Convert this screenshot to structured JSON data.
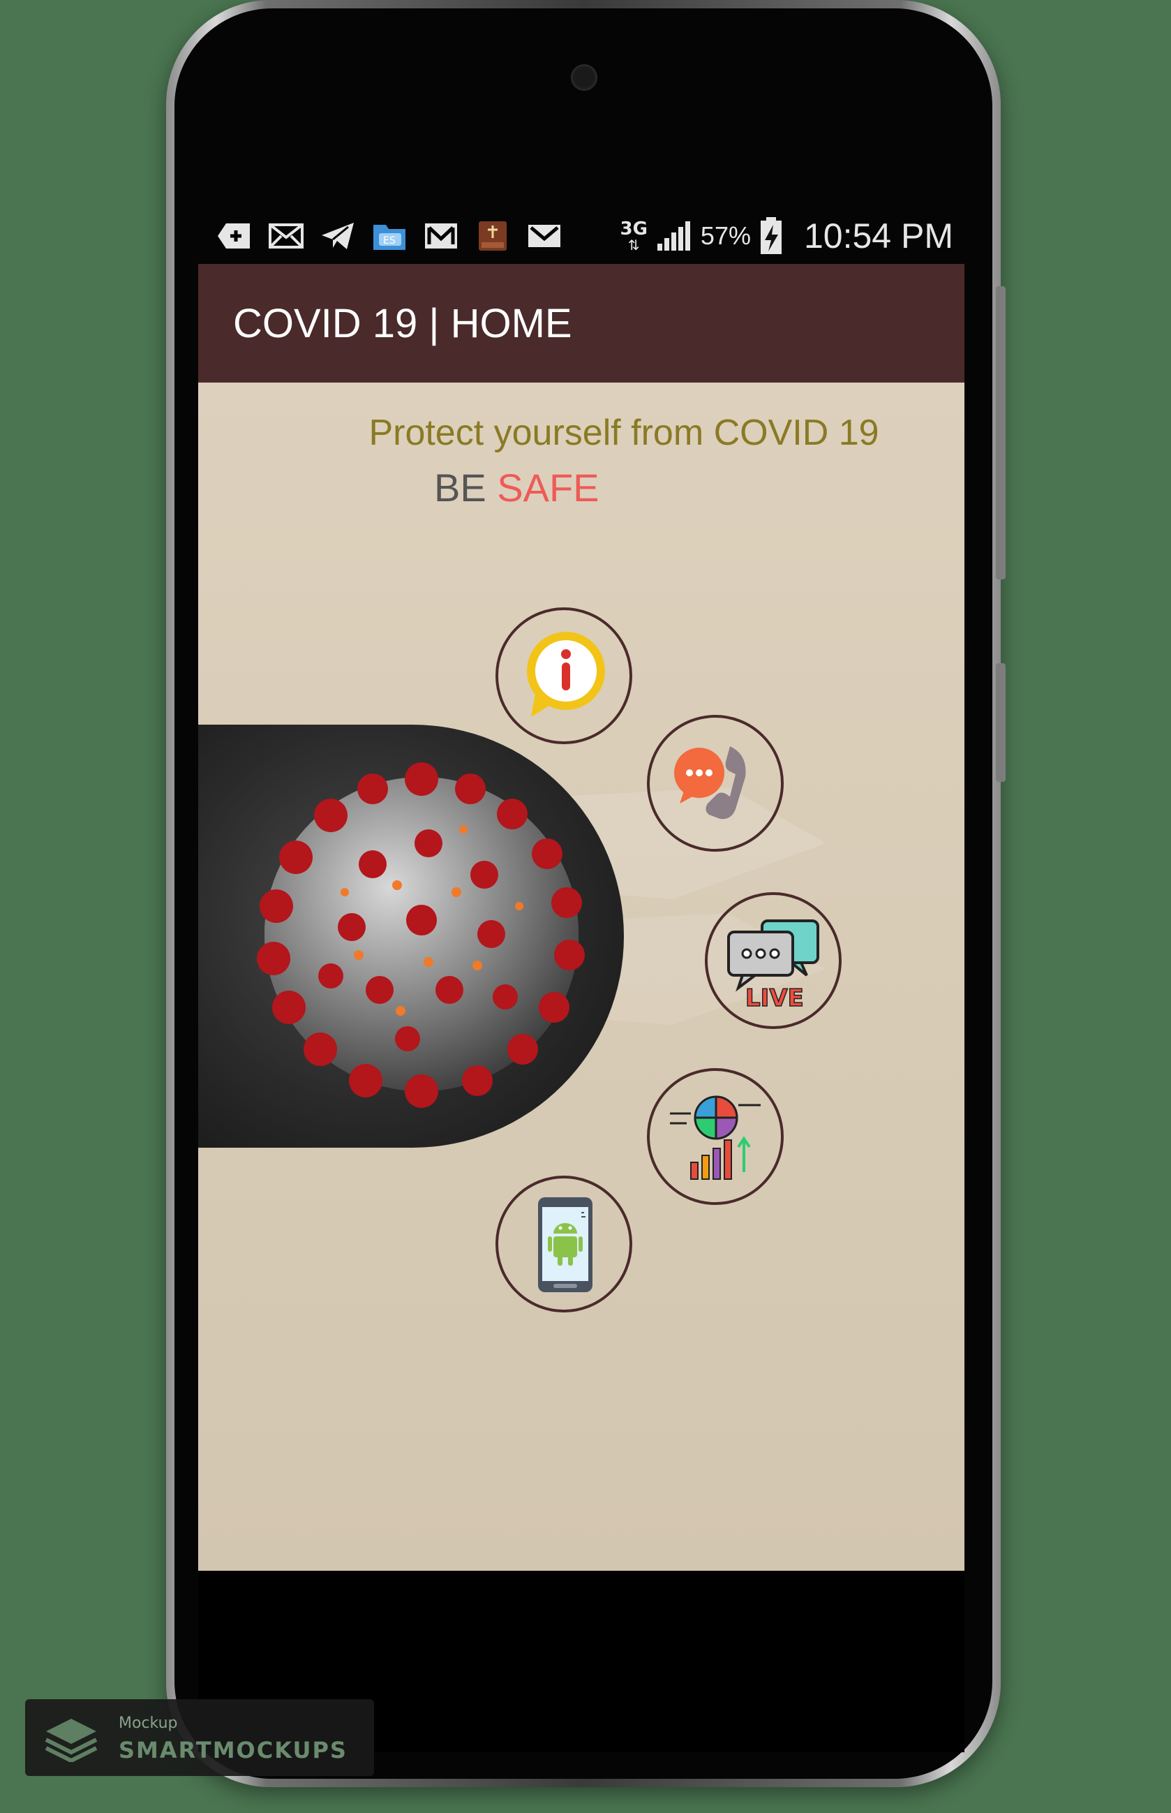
{
  "status_bar": {
    "network_label": "3G",
    "battery_percent": "57%",
    "time": "10:54 PM",
    "notification_icons": [
      "add-notification-icon",
      "mail-icon",
      "telegram-icon",
      "file-manager-icon",
      "gmail-icon",
      "bible-app-icon",
      "email-icon"
    ]
  },
  "app_bar": {
    "title": "COVID 19 | HOME"
  },
  "content": {
    "headline": "Protect yourself from COVID 19",
    "be_label": "BE",
    "safe_label": "SAFE",
    "menu": [
      {
        "name": "info-button",
        "icon": "info-icon"
      },
      {
        "name": "call-button",
        "icon": "phone-chat-icon"
      },
      {
        "name": "live-chat-button",
        "icon": "live-chat-icon"
      },
      {
        "name": "statistics-button",
        "icon": "stats-chart-icon"
      },
      {
        "name": "android-app-button",
        "icon": "android-phone-icon"
      }
    ],
    "colors": {
      "app_bar": "#4a2a2a",
      "background": "#d8ccb7",
      "headline": "#8a7a24",
      "safe": "#ee5b57"
    }
  },
  "watermark": {
    "small_text": "Mockup",
    "big_text": "SMARTMOCKUPS"
  }
}
